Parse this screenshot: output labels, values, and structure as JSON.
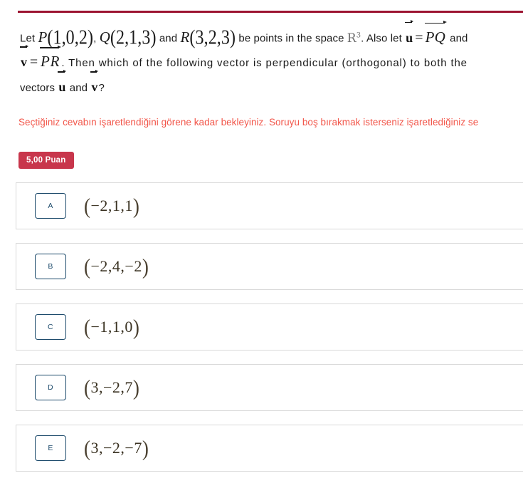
{
  "theme": {
    "rule_color": "#9c1431",
    "badge_bg": "#c8364c",
    "warning_color": "#f2564a",
    "letter_box_border": "#1c4a6b",
    "option_border": "#d9d9d9",
    "math_color": "#3a3222"
  },
  "question": {
    "line1": {
      "lead": "Let",
      "point_p": {
        "name": "P",
        "coords": "(1,0,2)"
      },
      "sep1": ",",
      "point_q": {
        "name": "Q",
        "coords": "(2,1,3)"
      },
      "conj1": "and",
      "point_r": {
        "name": "R",
        "coords": "(3,2,3)"
      },
      "mid": "be points in the space",
      "space": "R",
      "space_exp": "3",
      "after_space": ". Also let",
      "vec_u": "u",
      "equals": "=",
      "seg_pq": "PQ",
      "tail": "and"
    },
    "line2": {
      "vec_v": "v",
      "equals": "=",
      "seg_pr": "PR",
      "text": ". Then which of the following vector is perpendicular (orthogonal)  to both the"
    },
    "line3": {
      "lead": "vectors",
      "vec_u": "u",
      "conj": "and",
      "vec_v": "v",
      "tail": "?"
    }
  },
  "warning": {
    "text": "Seçtiğiniz cevabın işaretlendiğini görene kadar bekleyiniz. Soruyu boş bırakmak isterseniz işaretlediğiniz se"
  },
  "points_badge": {
    "label": "5,00 Puan"
  },
  "options": [
    {
      "letter": "A",
      "open": "(",
      "value": "−2,1,1",
      "close": ")"
    },
    {
      "letter": "B",
      "open": "(",
      "value": "−2,4,−2",
      "close": ")"
    },
    {
      "letter": "C",
      "open": "(",
      "value": "−1,1,0",
      "close": ")"
    },
    {
      "letter": "D",
      "open": "(",
      "value": "3,−2,7",
      "close": ")"
    },
    {
      "letter": "E",
      "open": "(",
      "value": "3,−2,−7",
      "close": ")"
    }
  ]
}
